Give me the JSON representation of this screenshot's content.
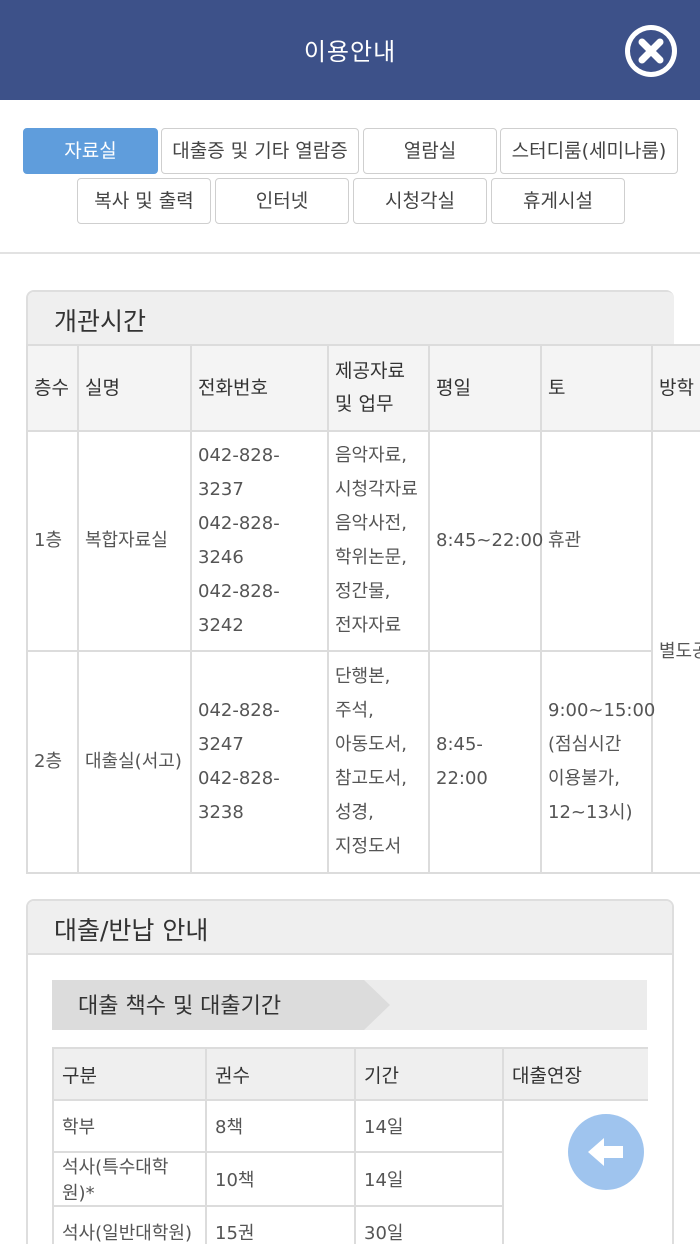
{
  "header": {
    "title": "이용안내",
    "close_icon": "close-icon"
  },
  "tabs": [
    {
      "label": "자료실",
      "active": true
    },
    {
      "label": "대출증 및 기타 열람증",
      "active": false
    },
    {
      "label": "열람실",
      "active": false
    },
    {
      "label": "스터디룸(세미나룸)",
      "active": false
    },
    {
      "label": "복사 및 출력",
      "active": false
    },
    {
      "label": "인터넷",
      "active": false
    },
    {
      "label": "시청각실",
      "active": false
    },
    {
      "label": "휴게시설",
      "active": false
    }
  ],
  "opening_hours": {
    "title": "개관시간",
    "headers": [
      "층수",
      "실명",
      "전화번호",
      "제공자료 및 업무",
      "평일",
      "토",
      "방학"
    ],
    "rows": [
      {
        "floor": "1층",
        "room": "복합자료실",
        "phones": [
          "042-828-3237",
          "042-828-3246",
          "042-828-3242"
        ],
        "materials": [
          "음악자료,",
          "시청각자료",
          "음악사전,",
          "학위논문,",
          "정간물,",
          "전자자료"
        ],
        "weekday": "8:45~22:00",
        "saturday": [
          "휴관"
        ]
      },
      {
        "floor": "2층",
        "room": "대출실(서고)",
        "phones": [
          "042-828-3247",
          "042-828-3238"
        ],
        "materials": [
          "단행본,",
          "주석,",
          "아동도서,",
          "참고도서,",
          "성경,",
          "지정도서"
        ],
        "weekday": "8:45-22:00",
        "saturday": [
          "9:00~15:00",
          "(점심시간",
          "이용불가,",
          "12~13시)"
        ]
      }
    ],
    "vacation_merged": "별도공"
  },
  "loan_info": {
    "title": "대출/반납 안내",
    "subtitle": "대출 책수 및 대출기간",
    "headers": [
      "구분",
      "권수",
      "기간",
      "대출연장"
    ],
    "rows": [
      {
        "category": "학부",
        "count": "8책",
        "period": "14일"
      },
      {
        "category": "석사(특수대학원)*",
        "count": "10책",
        "period": "14일"
      },
      {
        "category": "석사(일반대학원)",
        "count": "15권",
        "period": "30일"
      }
    ]
  },
  "floating": {
    "back_icon": "back-arrow-icon"
  },
  "colors": {
    "header": "#3d5189",
    "active_tab": "#5f9ddc",
    "back_button": "#8ebaeb"
  }
}
